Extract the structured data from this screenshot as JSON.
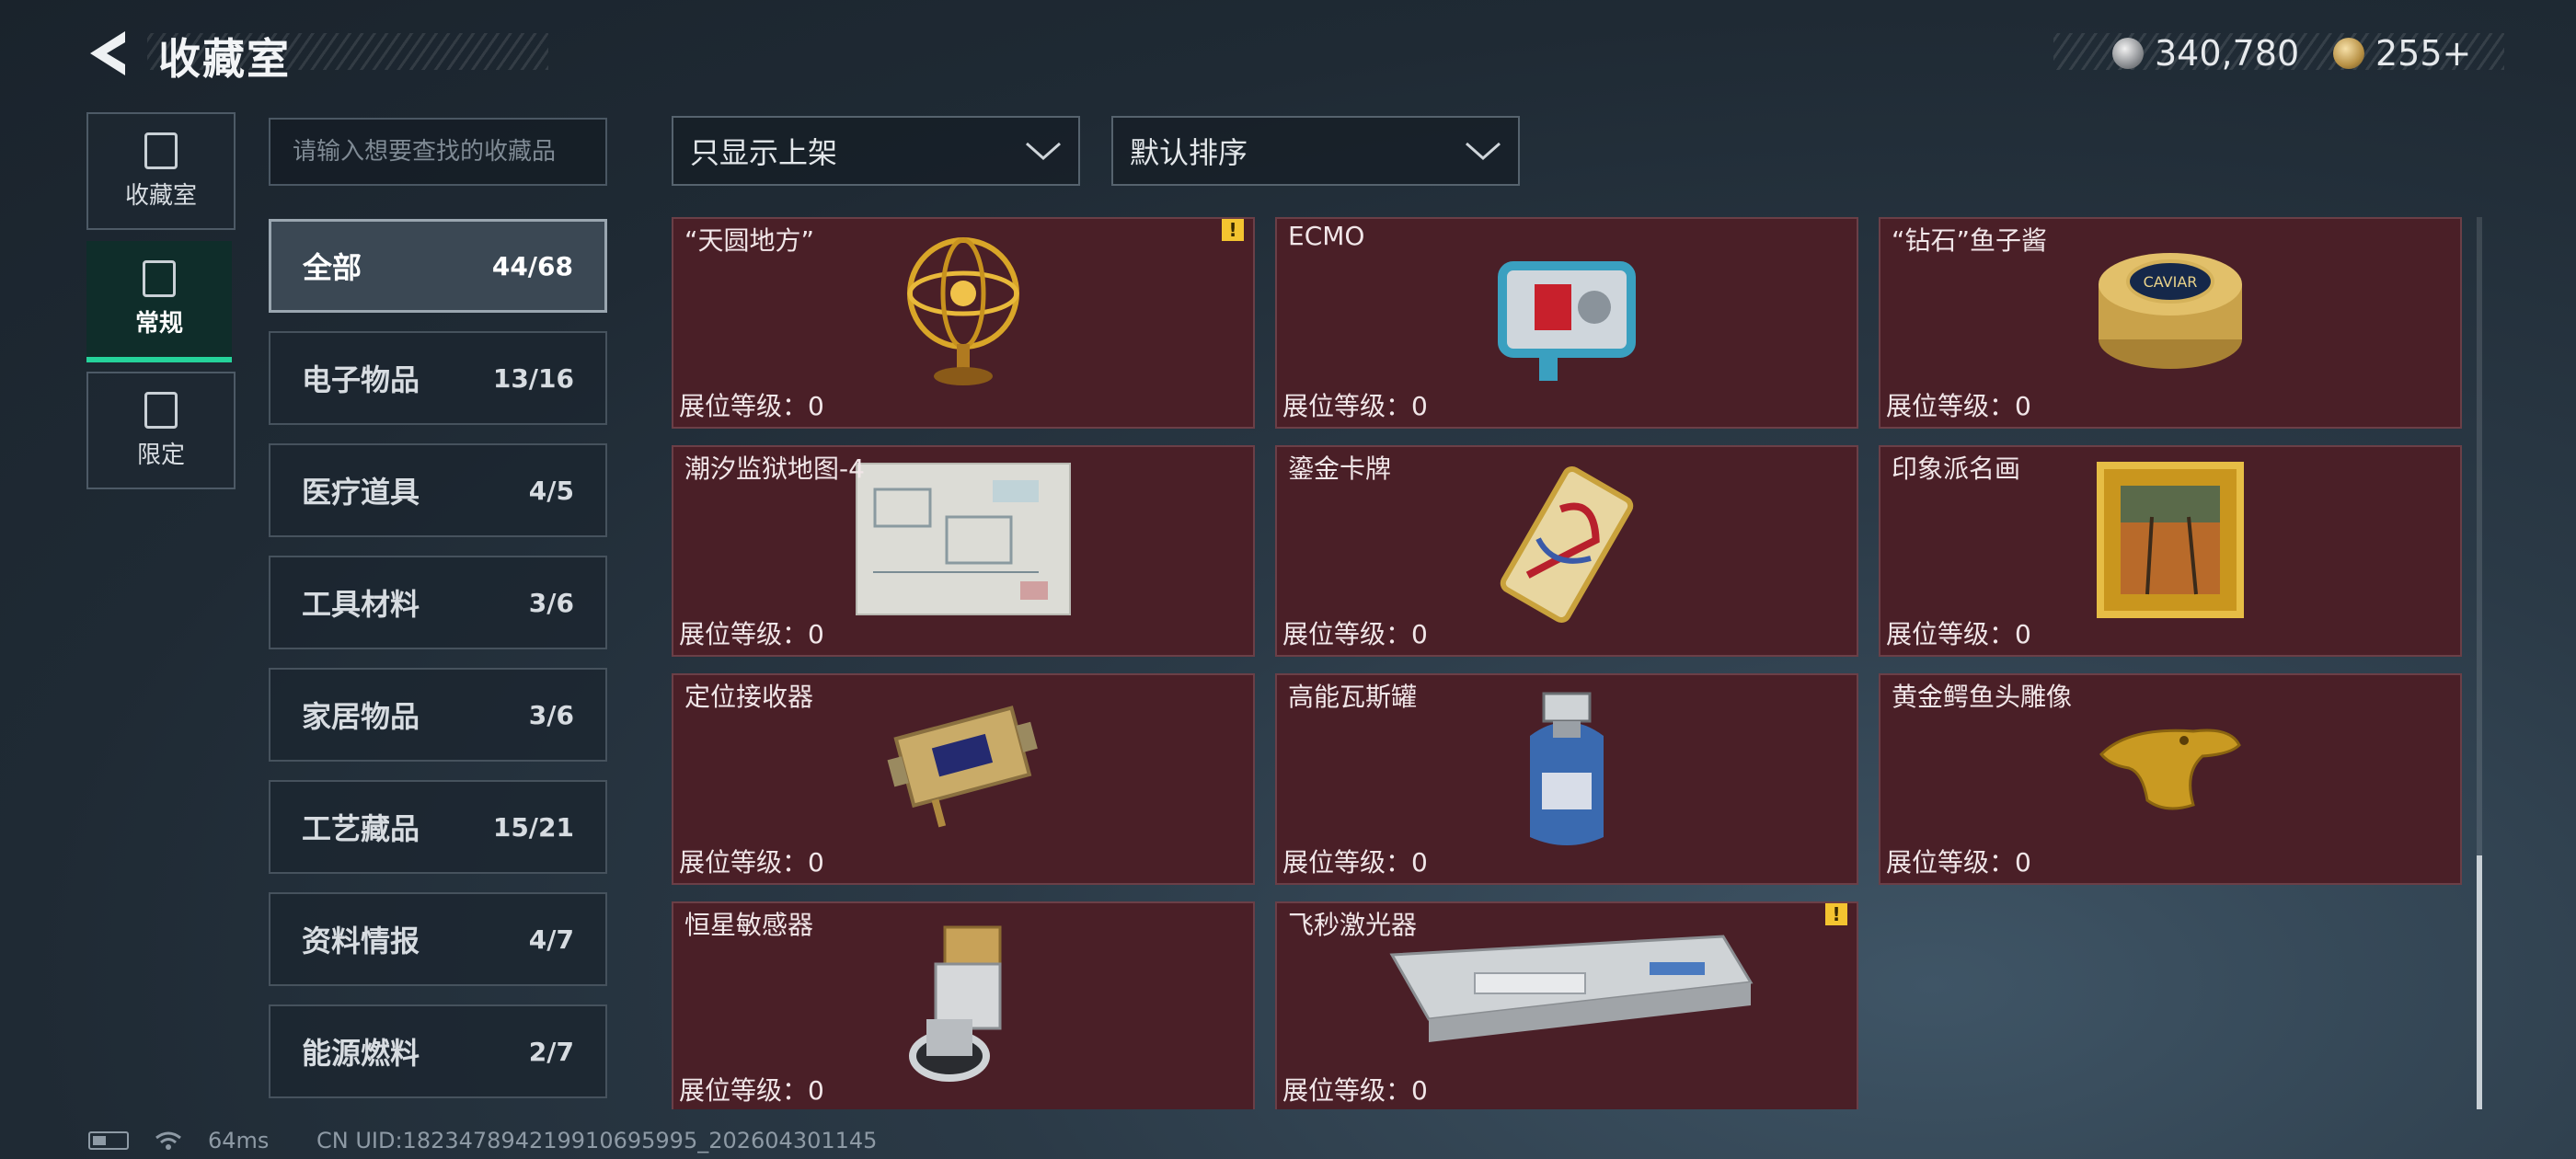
{
  "header": {
    "title": "收藏室"
  },
  "currency": {
    "silver": "340,780",
    "gold": "255+"
  },
  "side_tabs": [
    {
      "label": "收藏室",
      "active": false,
      "icon": "collection-icon"
    },
    {
      "label": "常规",
      "active": true,
      "icon": "regular-icon"
    },
    {
      "label": "限定",
      "active": false,
      "icon": "limited-icon"
    }
  ],
  "search": {
    "placeholder": "请输入想要查找的收藏品",
    "value": ""
  },
  "filters": {
    "display": "只显示上架",
    "sort": "默认排序"
  },
  "categories": [
    {
      "name": "全部",
      "count": "44/68",
      "active": true
    },
    {
      "name": "电子物品",
      "count": "13/16"
    },
    {
      "name": "医疗道具",
      "count": "4/5"
    },
    {
      "name": "工具材料",
      "count": "3/6"
    },
    {
      "name": "家居物品",
      "count": "3/6"
    },
    {
      "name": "工艺藏品",
      "count": "15/21"
    },
    {
      "name": "资料情报",
      "count": "4/7"
    },
    {
      "name": "能源燃料",
      "count": "2/7"
    }
  ],
  "items": [
    {
      "name": "“天圆地方”",
      "level": "展位等级：0",
      "warning": true,
      "icon": "armillary-sphere-icon"
    },
    {
      "name": "ECMO",
      "level": "展位等级：0",
      "warning": false,
      "icon": "ecmo-machine-icon"
    },
    {
      "name": "“钻石”鱼子酱",
      "level": "展位等级：0",
      "warning": false,
      "icon": "caviar-tin-icon"
    },
    {
      "name": "潮汐监狱地图-4",
      "level": "展位等级：0",
      "warning": false,
      "icon": "prison-map-icon"
    },
    {
      "name": "鎏金卡牌",
      "level": "展位等级：0",
      "warning": false,
      "icon": "gilded-card-icon"
    },
    {
      "name": "印象派名画",
      "level": "展位等级：0",
      "warning": false,
      "icon": "painting-icon"
    },
    {
      "name": "定位接收器",
      "level": "展位等级：0",
      "warning": false,
      "icon": "receiver-icon"
    },
    {
      "name": "高能瓦斯罐",
      "level": "展位等级：0",
      "warning": false,
      "icon": "gas-canister-icon"
    },
    {
      "name": "黄金鳄鱼头雕像",
      "level": "展位等级：0",
      "warning": false,
      "icon": "gold-crocodile-icon"
    },
    {
      "name": "恒星敏感器",
      "level": "展位等级：0",
      "warning": false,
      "icon": "star-sensor-icon"
    },
    {
      "name": "飞秒激光器",
      "level": "展位等级：0",
      "warning": true,
      "icon": "femtosecond-laser-icon"
    }
  ],
  "status": {
    "ping": "64ms",
    "uid": "CN UID:18234789421991069599​5_202604301145"
  },
  "colors": {
    "card_bg": "#4a1f27",
    "accent": "#25d39b",
    "warning": "#f4c430"
  }
}
